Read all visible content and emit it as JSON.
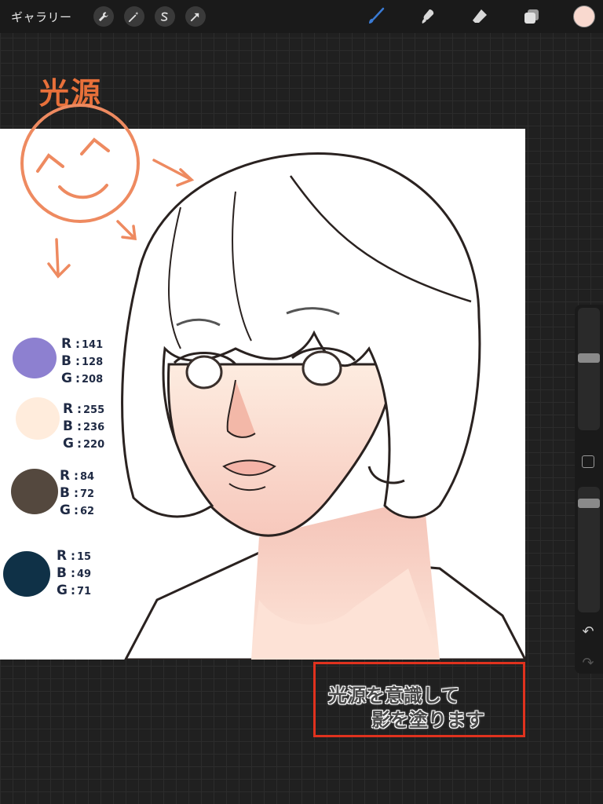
{
  "topbar": {
    "gallery_label": "ギャラリー",
    "left_tools": [
      "wrench-icon",
      "magic-wand-icon",
      "selection-s-icon",
      "transform-arrow-icon"
    ],
    "right_tools": [
      "brush-icon",
      "smudge-icon",
      "eraser-icon",
      "layers-icon"
    ],
    "current_color": "#f9d9cf",
    "brush_accent": "#3a7bd5"
  },
  "annotation": {
    "title": "光源",
    "title_color": "#e8703a"
  },
  "palette": [
    {
      "color": "#8d80d0",
      "labels": [
        "R",
        "B",
        "G"
      ],
      "values": [
        "141",
        "128",
        "208"
      ]
    },
    {
      "color": "#ffecdc",
      "labels": [
        "R",
        "B",
        "G"
      ],
      "values": [
        "255",
        "236",
        "220"
      ]
    },
    {
      "color": "#54483e",
      "labels": [
        "R",
        "B",
        "G"
      ],
      "values": [
        "84",
        "72",
        "62"
      ]
    },
    {
      "color": "#0f3147",
      "labels": [
        "R",
        "B",
        "G"
      ],
      "values": [
        "15",
        "49",
        "71"
      ]
    }
  ],
  "caption": {
    "line1": "光源を意識して",
    "line2": "影を塗ります",
    "border_color": "#e0321e"
  },
  "sidebar": {
    "size_slider_value": 0.6,
    "opacity_slider_value": 0.1
  }
}
